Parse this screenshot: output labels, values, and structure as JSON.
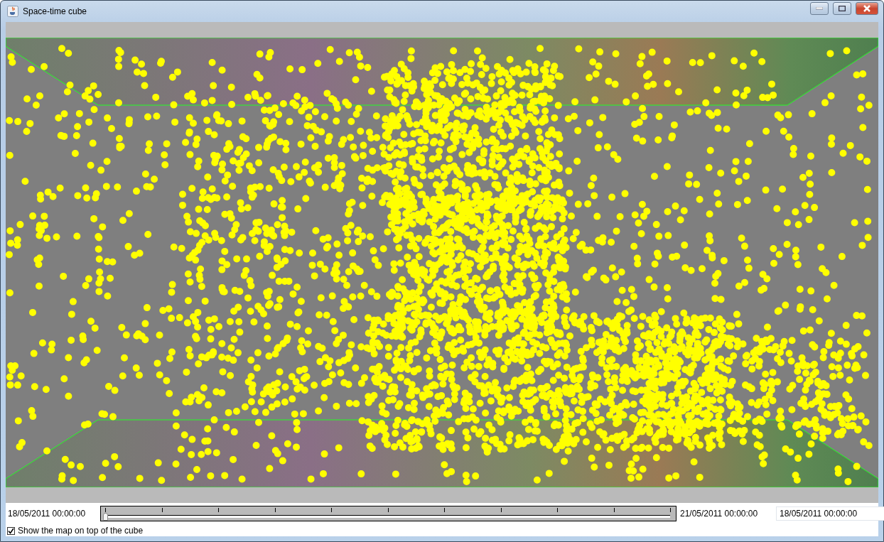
{
  "window": {
    "title": "Space-time cube"
  },
  "timeline": {
    "start": "18/05/2011 00:00:00",
    "end": "21/05/2011 00:00:00",
    "level": 0,
    "current": "18/05/2011 00:00:00"
  },
  "map_option": {
    "label": "Show the map on top of the cube",
    "checked": true
  }
}
